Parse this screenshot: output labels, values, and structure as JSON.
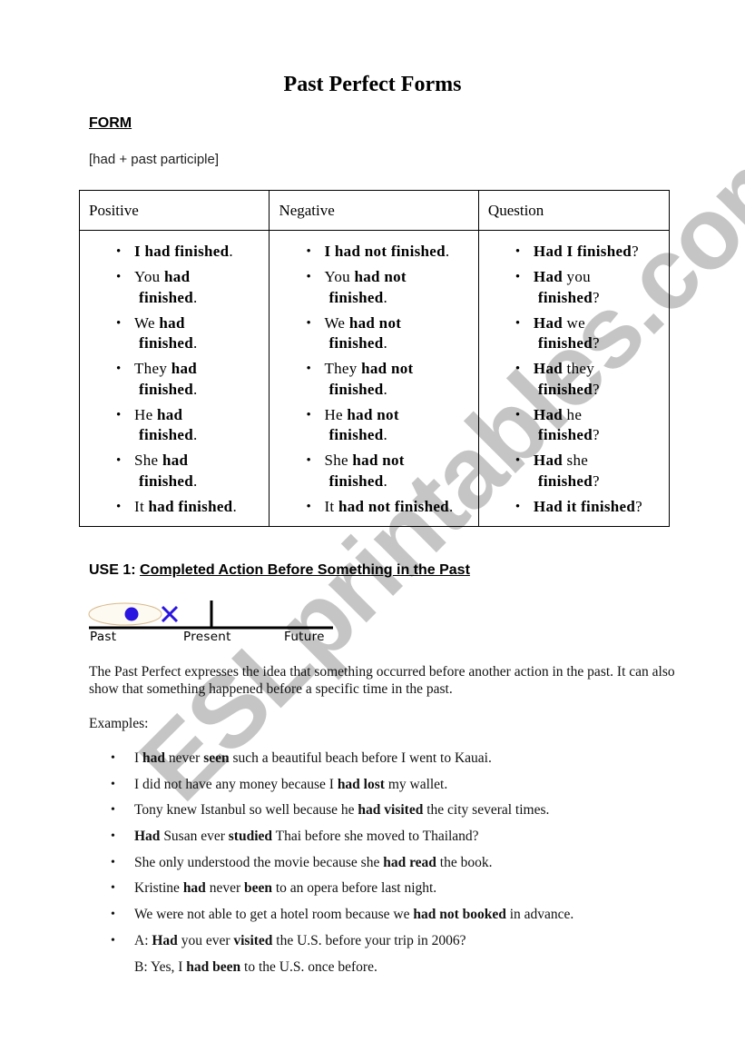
{
  "title": "Past Perfect Forms",
  "form_section": {
    "heading": "FORM",
    "formula": "[had + past participle]"
  },
  "forms_table": {
    "headers": [
      "Positive",
      "Negative",
      "Question"
    ],
    "columns": [
      [
        {
          "pre": "",
          "bold": "I had finished",
          "post": ".",
          "line2": ""
        },
        {
          "pre": "You ",
          "bold": "had",
          "post": "",
          "line2": "finished."
        },
        {
          "pre": "We ",
          "bold": "had",
          "post": "",
          "line2": "finished."
        },
        {
          "pre": "They ",
          "bold": "had",
          "post": "",
          "line2": "finished."
        },
        {
          "pre": "He ",
          "bold": "had",
          "post": "",
          "line2": "finished."
        },
        {
          "pre": "She ",
          "bold": "had",
          "post": "",
          "line2": "finished."
        },
        {
          "pre": "It ",
          "bold": "had finished",
          "post": ".",
          "line2": ""
        }
      ],
      [
        {
          "pre": "",
          "bold": "I had not finished",
          "post": ".",
          "line2": ""
        },
        {
          "pre": "You ",
          "bold": "had not",
          "post": "",
          "line2": "finished."
        },
        {
          "pre": "We ",
          "bold": "had not",
          "post": "",
          "line2": "finished."
        },
        {
          "pre": "They ",
          "bold": "had not",
          "post": "",
          "line2": "finished."
        },
        {
          "pre": "He ",
          "bold": "had not",
          "post": "",
          "line2": "finished."
        },
        {
          "pre": "She ",
          "bold": "had not",
          "post": "",
          "line2": "finished."
        },
        {
          "pre": "It ",
          "bold": "had not finished",
          "post": ".",
          "line2": ""
        }
      ],
      [
        {
          "pre": "",
          "bold": "Had I finished",
          "post": "?",
          "line2": ""
        },
        {
          "pre": "",
          "bold": "Had",
          "post": " you",
          "line2": "finished?"
        },
        {
          "pre": "",
          "bold": "Had",
          "post": " we",
          "line2": "finished?"
        },
        {
          "pre": "",
          "bold": "Had",
          "post": " they",
          "line2": "finished?"
        },
        {
          "pre": "",
          "bold": "Had",
          "post": " he",
          "line2": "finished?"
        },
        {
          "pre": "",
          "bold": "Had",
          "post": " she",
          "line2": "finished?"
        },
        {
          "pre": "",
          "bold": "Had it finished",
          "post": "?",
          "line2": ""
        }
      ]
    ]
  },
  "use1": {
    "label": "USE 1: ",
    "title": "Completed Action Before Something in the Past",
    "timeline": {
      "labels": [
        "Past",
        "Present",
        "Future"
      ],
      "marker_color": "#2a14e0",
      "ellipse_color": "#d8b98a"
    },
    "paragraph": "The Past Perfect expresses the idea that something occurred before another action in the past. It can also show that something happened before a specific time in the past.",
    "examples_label": "Examples:",
    "examples": [
      [
        {
          "t": "I "
        },
        {
          "b": "had"
        },
        {
          "t": " never "
        },
        {
          "b": "seen"
        },
        {
          "t": " such a beautiful beach before I went to Kauai."
        }
      ],
      [
        {
          "t": "I did not have any money because I "
        },
        {
          "b": "had lost"
        },
        {
          "t": " my wallet."
        }
      ],
      [
        {
          "t": "Tony knew Istanbul so well because he "
        },
        {
          "b": "had visited"
        },
        {
          "t": " the city several times."
        }
      ],
      [
        {
          "b": "Had"
        },
        {
          "t": " Susan ever "
        },
        {
          "b": "studied"
        },
        {
          "t": " Thai before she moved to Thailand?"
        }
      ],
      [
        {
          "t": "She only understood the movie because she "
        },
        {
          "b": "had read"
        },
        {
          "t": " the book."
        }
      ],
      [
        {
          "t": "Kristine "
        },
        {
          "b": "had"
        },
        {
          "t": " never "
        },
        {
          "b": "been"
        },
        {
          "t": " to an opera before last night."
        }
      ],
      [
        {
          "t": "We were not able to get a hotel room because we "
        },
        {
          "b": "had not booked"
        },
        {
          "t": " in advance."
        }
      ],
      [
        {
          "t": "A: "
        },
        {
          "b": "Had"
        },
        {
          "t": " you ever "
        },
        {
          "b": "visited"
        },
        {
          "t": " the U.S. before your trip in 2006?"
        }
      ]
    ],
    "dialogue_reply": [
      {
        "t": "B: Yes, I "
      },
      {
        "b": "had been"
      },
      {
        "t": " to the U.S. once before."
      }
    ]
  },
  "watermark": "ESLprintables.com"
}
